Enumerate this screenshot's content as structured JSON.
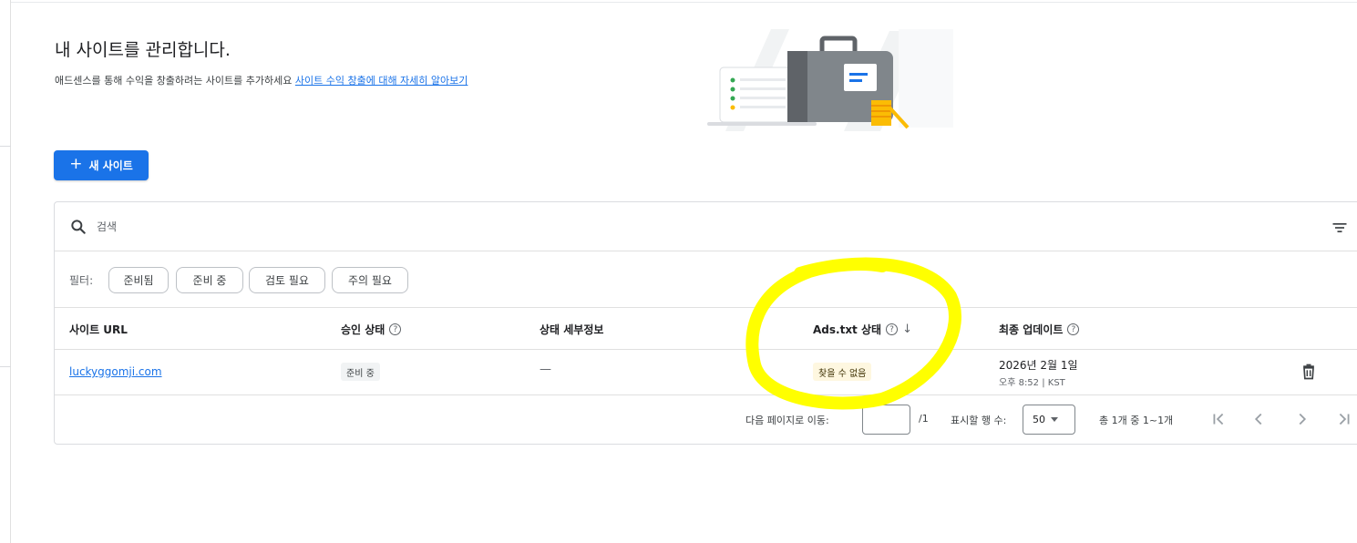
{
  "page": {
    "title": "내 사이트를 관리합니다.",
    "subtitle_text": "애드센스를 통해 수익을 창출하려는 사이트를 추가하세요",
    "subtitle_link": "사이트 수익 창출에 대해 자세히 알아보기"
  },
  "new_site_button": {
    "label": "새 사이트"
  },
  "search": {
    "placeholder": "검색"
  },
  "filters": {
    "label": "필터:",
    "chips": [
      "준비됨",
      "준비 중",
      "검토 필요",
      "주의 필요"
    ]
  },
  "table": {
    "columns": [
      "사이트 URL",
      "승인 상태",
      "상태 세부정보",
      "Ads.txt 상태",
      "최종 업데이트"
    ],
    "sorted_column": "Ads.txt 상태",
    "rows": [
      {
        "site_url": "luckyggomji.com",
        "approval_status": "준비 중",
        "status_details": "—",
        "ads_txt_status": "찾을 수 없음",
        "last_updated_date": "2026년 2월 1일",
        "last_updated_time": "오후 8:52 | KST"
      }
    ]
  },
  "pagination": {
    "goto_label": "다음 페이지로 이동:",
    "goto_value": "",
    "total_pages": "/1",
    "rows_label": "표시할 행 수:",
    "rows_value": "50",
    "range_text": "총 1개 중 1~1개"
  },
  "colors": {
    "primary": "#1a73e8",
    "warning_badge_bg": "#fef7e0",
    "annotation": "#ffff00"
  }
}
